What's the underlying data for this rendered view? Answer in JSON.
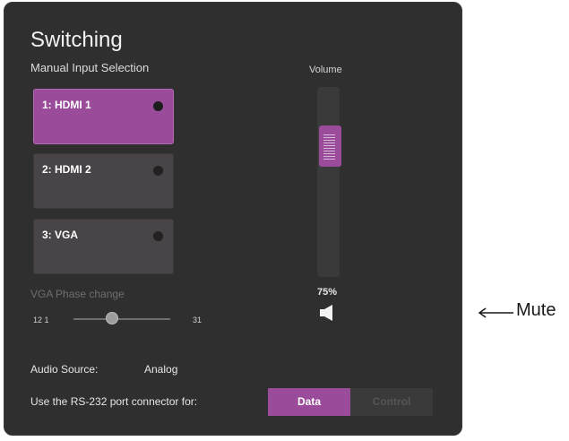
{
  "panel": {
    "title": "Switching",
    "subtitle": "Manual Input Selection"
  },
  "inputs": [
    {
      "label": "1: HDMI 1",
      "active": true
    },
    {
      "label": "2: HDMI 2",
      "active": false
    },
    {
      "label": "3: VGA",
      "active": false
    }
  ],
  "vga_phase": {
    "label": "VGA Phase change",
    "min_label": "12 1",
    "max_label": "31",
    "value_fraction": 0.35
  },
  "volume": {
    "label": "Volume",
    "percent": "75%",
    "mute_icon": "speaker-icon"
  },
  "audio": {
    "label": "Audio Source:",
    "value": "Analog"
  },
  "rs232": {
    "label": "Use the RS-232 port connector for:",
    "options": [
      "Data",
      "Control"
    ],
    "selected": "Data"
  },
  "annotation": {
    "text": "Mute"
  },
  "colors": {
    "accent": "#9a4c9b",
    "panel_bg": "#2f2f2f",
    "button_bg": "#484447"
  }
}
